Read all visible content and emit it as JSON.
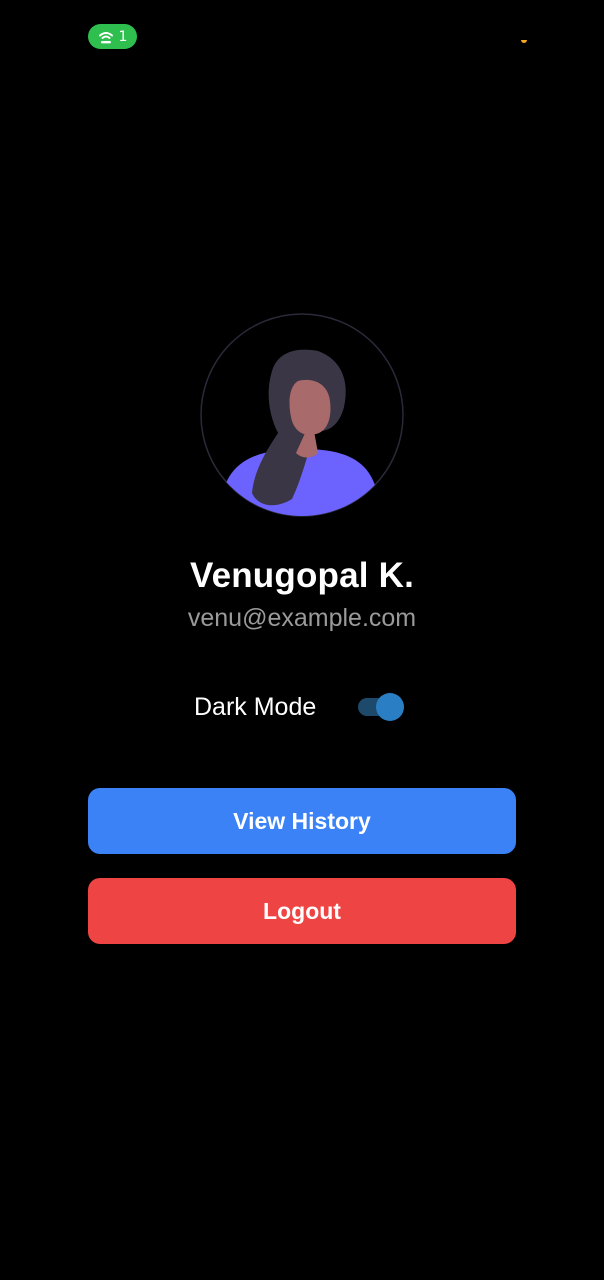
{
  "status_bar": {
    "hotspot_icon": "wifi-hotspot-icon",
    "hotspot_count": "1",
    "hotspot_color": "#2fbf4f",
    "indicator_color": "#f5a623"
  },
  "profile": {
    "avatar_icon": "female-avatar-illustration",
    "name": "Venugopal K.",
    "email": "venu@example.com"
  },
  "settings": {
    "dark_mode_label": "Dark Mode",
    "dark_mode_enabled": true
  },
  "actions": {
    "view_history_label": "View History",
    "logout_label": "Logout"
  },
  "colors": {
    "background": "#000000",
    "primary": "#3b82f6",
    "danger": "#ef4444",
    "avatar_accent": "#6c63ff"
  }
}
